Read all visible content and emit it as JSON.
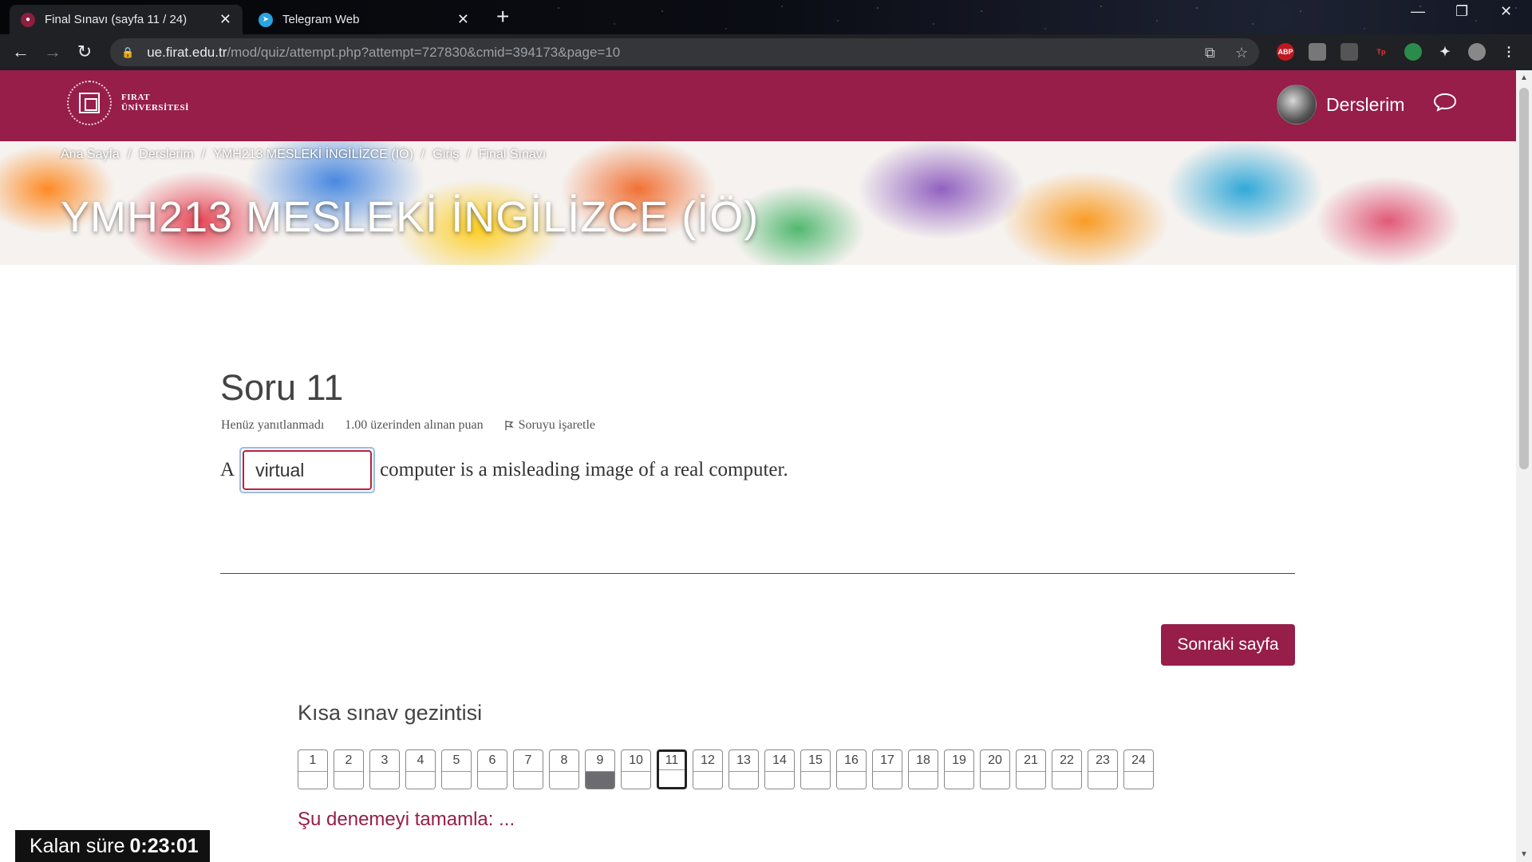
{
  "browser": {
    "tabs": [
      {
        "title": "Final Sınavı (sayfa 11 / 24)",
        "active": true
      },
      {
        "title": "Telegram Web",
        "active": false
      }
    ],
    "url_host": "ue.firat.edu.tr",
    "url_path": "/mod/quiz/attempt.php?attempt=727830&cmid=394173&page=10",
    "extensions": [
      "ABP",
      "Tp"
    ]
  },
  "header": {
    "logo_line1": "FIRAT",
    "logo_line2": "ÜNİVERSİTESİ",
    "user_menu_label": "Derslerim",
    "brand_color": "#961e48"
  },
  "breadcrumb": [
    "Ana Sayfa",
    "Derslerim",
    "YMH213 MESLEKİ İNGİLİZCE (İÖ)",
    "Giriş",
    "Final Sınavı"
  ],
  "course_title": "YMH213 MESLEKİ İNGİLİZCE (İÖ)",
  "question": {
    "title": "Soru 11",
    "status": "Henüz yanıtlanmadı",
    "mark": "1.00 üzerinden alınan puan",
    "flag_label": "Soruyu işaretle",
    "text_before": "A",
    "answer_value": "virtual",
    "text_after": "computer is a misleading image of a real computer."
  },
  "next_button": "Sonraki sayfa",
  "quiz_nav": {
    "title": "Kısa sınav gezintisi",
    "questions": [
      "1",
      "2",
      "3",
      "4",
      "5",
      "6",
      "7",
      "8",
      "9",
      "10",
      "11",
      "12",
      "13",
      "14",
      "15",
      "16",
      "17",
      "18",
      "19",
      "20",
      "21",
      "22",
      "23",
      "24"
    ],
    "answered": [
      "9"
    ],
    "current": "11",
    "finish_label": "Şu denemeyi tamamla: ..."
  },
  "timer": {
    "label": "Kalan süre",
    "value": "0:23:01"
  }
}
